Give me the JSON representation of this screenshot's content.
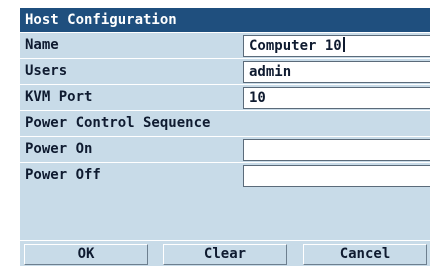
{
  "dialog": {
    "title": "Host Configuration",
    "fields": [
      {
        "label": "Name",
        "value": "Computer 10"
      },
      {
        "label": "Users",
        "value": "admin"
      },
      {
        "label": "KVM Port",
        "value": "10"
      }
    ],
    "section_label": "Power Control Sequence",
    "power_fields": [
      {
        "label": "Power On",
        "value": ""
      },
      {
        "label": "Power Off",
        "value": ""
      }
    ],
    "buttons": {
      "ok": "OK",
      "clear": "Clear",
      "cancel": "Cancel"
    }
  },
  "colors": {
    "title_bar": "#1f4f7e",
    "panel_background": "#c8dbe8",
    "text": "#0f1b30"
  }
}
